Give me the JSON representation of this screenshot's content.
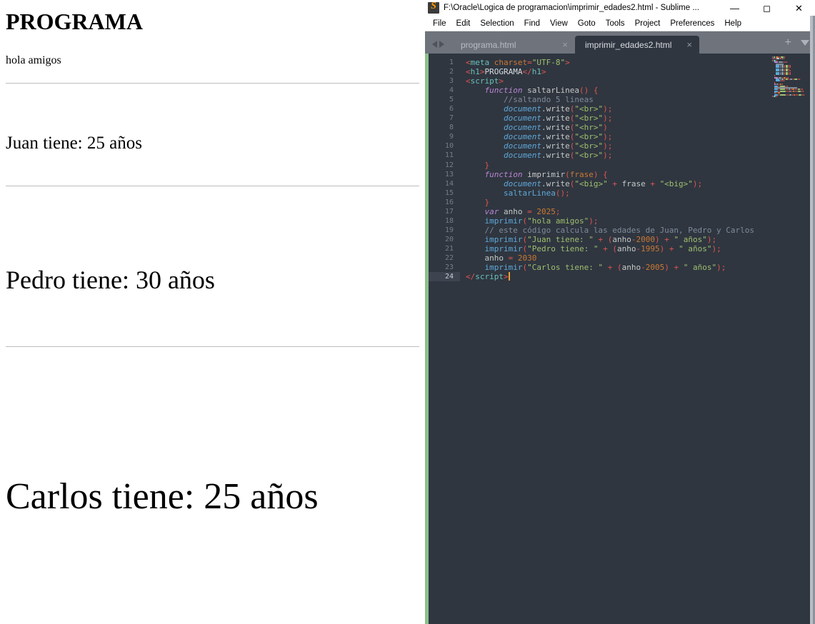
{
  "browser": {
    "heading": "PROGRAMA",
    "lines": [
      {
        "text": "hola amigos",
        "size": "sz1"
      },
      {
        "text": "Juan tiene: 25 años",
        "size": "sz2"
      },
      {
        "text": "Pedro tiene: 30 años",
        "size": "sz3"
      },
      {
        "text": "Carlos tiene: 25 años",
        "size": "sz4"
      }
    ]
  },
  "sublime": {
    "title": "F:\\Oracle\\Logica de programacion\\imprimir_edades2.html - Sublime ...",
    "logo_letter": "S",
    "window_buttons": [
      {
        "name": "minimize",
        "glyph": "—"
      },
      {
        "name": "maximize",
        "glyph": "◻"
      },
      {
        "name": "close",
        "glyph": "✕"
      }
    ],
    "menu": [
      {
        "label": "File",
        "accel": "F"
      },
      {
        "label": "Edit",
        "accel": "E"
      },
      {
        "label": "Selection",
        "accel": "S"
      },
      {
        "label": "Find",
        "accel": "n"
      },
      {
        "label": "View",
        "accel": "V"
      },
      {
        "label": "Goto",
        "accel": "G"
      },
      {
        "label": "Tools",
        "accel": "T"
      },
      {
        "label": "Project",
        "accel": "P"
      },
      {
        "label": "Preferences",
        "accel": "n"
      },
      {
        "label": "Help",
        "accel": "H"
      }
    ],
    "tabs": [
      {
        "label": "programa.html",
        "active": false,
        "close": "×"
      },
      {
        "label": "imprimir_edades2.html",
        "active": true,
        "close": "×"
      }
    ],
    "tab_controls": {
      "new_tab": "+",
      "tab_menu": "▼"
    },
    "cursor_line": 24,
    "code_lines": [
      {
        "n": 1,
        "tokens": [
          [
            "punc",
            "<"
          ],
          [
            "tag",
            "meta"
          ],
          [
            "plain",
            " "
          ],
          [
            "attr",
            "charset"
          ],
          [
            "op",
            "="
          ],
          [
            "str",
            "\"UTF-8\""
          ],
          [
            "punc",
            ">"
          ]
        ]
      },
      {
        "n": 2,
        "tokens": [
          [
            "punc",
            "<"
          ],
          [
            "tag",
            "h1"
          ],
          [
            "punc",
            ">"
          ],
          [
            "txt-h1",
            "PROGRAMA"
          ],
          [
            "punc",
            "</"
          ],
          [
            "tag",
            "h1"
          ],
          [
            "punc",
            ">"
          ]
        ]
      },
      {
        "n": 3,
        "tokens": [
          [
            "punc",
            "<"
          ],
          [
            "tag",
            "script"
          ],
          [
            "punc",
            ">"
          ]
        ]
      },
      {
        "n": 4,
        "tokens": [
          [
            "plain",
            "    "
          ],
          [
            "kw",
            "function"
          ],
          [
            "plain",
            " "
          ],
          [
            "plain",
            "saltarLinea"
          ],
          [
            "punc",
            "("
          ],
          [
            "punc",
            ")"
          ],
          [
            "plain",
            " "
          ],
          [
            "punc",
            "{"
          ]
        ]
      },
      {
        "n": 5,
        "tokens": [
          [
            "plain",
            "        "
          ],
          [
            "cmt",
            "//saltando 5 lineas"
          ]
        ]
      },
      {
        "n": 6,
        "tokens": [
          [
            "plain",
            "        "
          ],
          [
            "obj",
            "document"
          ],
          [
            "plain",
            "."
          ],
          [
            "plain",
            "write"
          ],
          [
            "punc",
            "("
          ],
          [
            "str",
            "\"<br>\""
          ],
          [
            "punc",
            ")"
          ],
          [
            "punc",
            ";"
          ]
        ]
      },
      {
        "n": 7,
        "tokens": [
          [
            "plain",
            "        "
          ],
          [
            "obj",
            "document"
          ],
          [
            "plain",
            "."
          ],
          [
            "plain",
            "write"
          ],
          [
            "punc",
            "("
          ],
          [
            "str",
            "\"<br>\""
          ],
          [
            "punc",
            ")"
          ],
          [
            "punc",
            ";"
          ]
        ]
      },
      {
        "n": 8,
        "tokens": [
          [
            "plain",
            "        "
          ],
          [
            "obj",
            "document"
          ],
          [
            "plain",
            "."
          ],
          [
            "plain",
            "write"
          ],
          [
            "punc",
            "("
          ],
          [
            "str",
            "\"<hr>\""
          ],
          [
            "punc",
            ")"
          ]
        ]
      },
      {
        "n": 9,
        "tokens": [
          [
            "plain",
            "        "
          ],
          [
            "obj",
            "document"
          ],
          [
            "plain",
            "."
          ],
          [
            "plain",
            "write"
          ],
          [
            "punc",
            "("
          ],
          [
            "str",
            "\"<br>\""
          ],
          [
            "punc",
            ")"
          ],
          [
            "punc",
            ";"
          ]
        ]
      },
      {
        "n": 10,
        "tokens": [
          [
            "plain",
            "        "
          ],
          [
            "obj",
            "document"
          ],
          [
            "plain",
            "."
          ],
          [
            "plain",
            "write"
          ],
          [
            "punc",
            "("
          ],
          [
            "str",
            "\"<br>\""
          ],
          [
            "punc",
            ")"
          ],
          [
            "punc",
            ";"
          ]
        ]
      },
      {
        "n": 11,
        "tokens": [
          [
            "plain",
            "        "
          ],
          [
            "obj",
            "document"
          ],
          [
            "plain",
            "."
          ],
          [
            "plain",
            "write"
          ],
          [
            "punc",
            "("
          ],
          [
            "str",
            "\"<br>\""
          ],
          [
            "punc",
            ")"
          ],
          [
            "punc",
            ";"
          ]
        ]
      },
      {
        "n": 12,
        "tokens": [
          [
            "plain",
            "    "
          ],
          [
            "punc",
            "}"
          ]
        ]
      },
      {
        "n": 13,
        "tokens": [
          [
            "plain",
            "    "
          ],
          [
            "kw",
            "function"
          ],
          [
            "plain",
            " "
          ],
          [
            "plain",
            "imprimir"
          ],
          [
            "punc",
            "("
          ],
          [
            "param",
            "frase"
          ],
          [
            "punc",
            ")"
          ],
          [
            "plain",
            " "
          ],
          [
            "punc",
            "{"
          ]
        ]
      },
      {
        "n": 14,
        "tokens": [
          [
            "plain",
            "        "
          ],
          [
            "obj",
            "document"
          ],
          [
            "plain",
            "."
          ],
          [
            "plain",
            "write"
          ],
          [
            "punc",
            "("
          ],
          [
            "str",
            "\"<big>\""
          ],
          [
            "plain",
            " "
          ],
          [
            "op",
            "+"
          ],
          [
            "plain",
            " frase "
          ],
          [
            "op",
            "+"
          ],
          [
            "plain",
            " "
          ],
          [
            "str",
            "\"<big>\""
          ],
          [
            "punc",
            ")"
          ],
          [
            "punc",
            ";"
          ]
        ]
      },
      {
        "n": 15,
        "tokens": [
          [
            "plain",
            "        "
          ],
          [
            "fn",
            "saltarLinea"
          ],
          [
            "punc",
            "("
          ],
          [
            "punc",
            ")"
          ],
          [
            "punc",
            ";"
          ]
        ]
      },
      {
        "n": 16,
        "tokens": [
          [
            "plain",
            "    "
          ],
          [
            "punc",
            "}"
          ]
        ]
      },
      {
        "n": 17,
        "tokens": [
          [
            "plain",
            "    "
          ],
          [
            "kw",
            "var"
          ],
          [
            "plain",
            " anho "
          ],
          [
            "op",
            "="
          ],
          [
            "plain",
            " "
          ],
          [
            "num",
            "2025"
          ],
          [
            "punc",
            ";"
          ]
        ]
      },
      {
        "n": 18,
        "tokens": [
          [
            "plain",
            "    "
          ],
          [
            "fn",
            "imprimir"
          ],
          [
            "punc",
            "("
          ],
          [
            "str",
            "\"hola amigos\""
          ],
          [
            "punc",
            ")"
          ],
          [
            "punc",
            ";"
          ]
        ]
      },
      {
        "n": 19,
        "tokens": [
          [
            "plain",
            "    "
          ],
          [
            "cmt",
            "// este código calcula las edades de Juan, Pedro y Carlos"
          ]
        ]
      },
      {
        "n": 20,
        "tokens": [
          [
            "plain",
            "    "
          ],
          [
            "fn",
            "imprimir"
          ],
          [
            "punc",
            "("
          ],
          [
            "str",
            "\"Juan tiene: \""
          ],
          [
            "plain",
            " "
          ],
          [
            "op",
            "+"
          ],
          [
            "plain",
            " "
          ],
          [
            "punc",
            "("
          ],
          [
            "plain",
            "anho"
          ],
          [
            "op",
            "-"
          ],
          [
            "num",
            "2000"
          ],
          [
            "punc",
            ")"
          ],
          [
            "plain",
            " "
          ],
          [
            "op",
            "+"
          ],
          [
            "plain",
            " "
          ],
          [
            "str",
            "\" años\""
          ],
          [
            "punc",
            ")"
          ],
          [
            "punc",
            ";"
          ]
        ]
      },
      {
        "n": 21,
        "tokens": [
          [
            "plain",
            "    "
          ],
          [
            "fn",
            "imprimir"
          ],
          [
            "punc",
            "("
          ],
          [
            "str",
            "\"Pedro tiene: \""
          ],
          [
            "plain",
            " "
          ],
          [
            "op",
            "+"
          ],
          [
            "plain",
            " "
          ],
          [
            "punc",
            "("
          ],
          [
            "plain",
            "anho"
          ],
          [
            "op",
            "-"
          ],
          [
            "num",
            "1995"
          ],
          [
            "punc",
            ")"
          ],
          [
            "plain",
            " "
          ],
          [
            "op",
            "+"
          ],
          [
            "plain",
            " "
          ],
          [
            "str",
            "\" años\""
          ],
          [
            "punc",
            ")"
          ],
          [
            "punc",
            ";"
          ]
        ]
      },
      {
        "n": 22,
        "tokens": [
          [
            "plain",
            "    anho "
          ],
          [
            "op",
            "="
          ],
          [
            "plain",
            " "
          ],
          [
            "num",
            "2030"
          ]
        ]
      },
      {
        "n": 23,
        "tokens": [
          [
            "plain",
            "    "
          ],
          [
            "fn",
            "imprimir"
          ],
          [
            "punc",
            "("
          ],
          [
            "str",
            "\"Carlos tiene: \""
          ],
          [
            "plain",
            " "
          ],
          [
            "op",
            "+"
          ],
          [
            "plain",
            " "
          ],
          [
            "punc",
            "("
          ],
          [
            "plain",
            "anho"
          ],
          [
            "op",
            "-"
          ],
          [
            "num",
            "2005"
          ],
          [
            "punc",
            ")"
          ],
          [
            "plain",
            " "
          ],
          [
            "op",
            "+"
          ],
          [
            "plain",
            " "
          ],
          [
            "str",
            "\" años\""
          ],
          [
            "punc",
            ")"
          ],
          [
            "punc",
            ";"
          ]
        ]
      },
      {
        "n": 24,
        "tokens": [
          [
            "punc",
            "</"
          ],
          [
            "tag",
            "script"
          ],
          [
            "punc",
            ">"
          ]
        ],
        "cursor": true
      }
    ],
    "colors": {
      "editor_bg": "#2f3640",
      "chrome_bg": "#6e737c",
      "accent_cursor": "#f0a030",
      "string": "#9fbf6e",
      "comment": "#7f8a99",
      "keyword": "#bb86d4",
      "number": "#cc7832",
      "tag": "#69c0b8",
      "punctuation": "#e0544e",
      "function": "#5fa8d8"
    }
  }
}
